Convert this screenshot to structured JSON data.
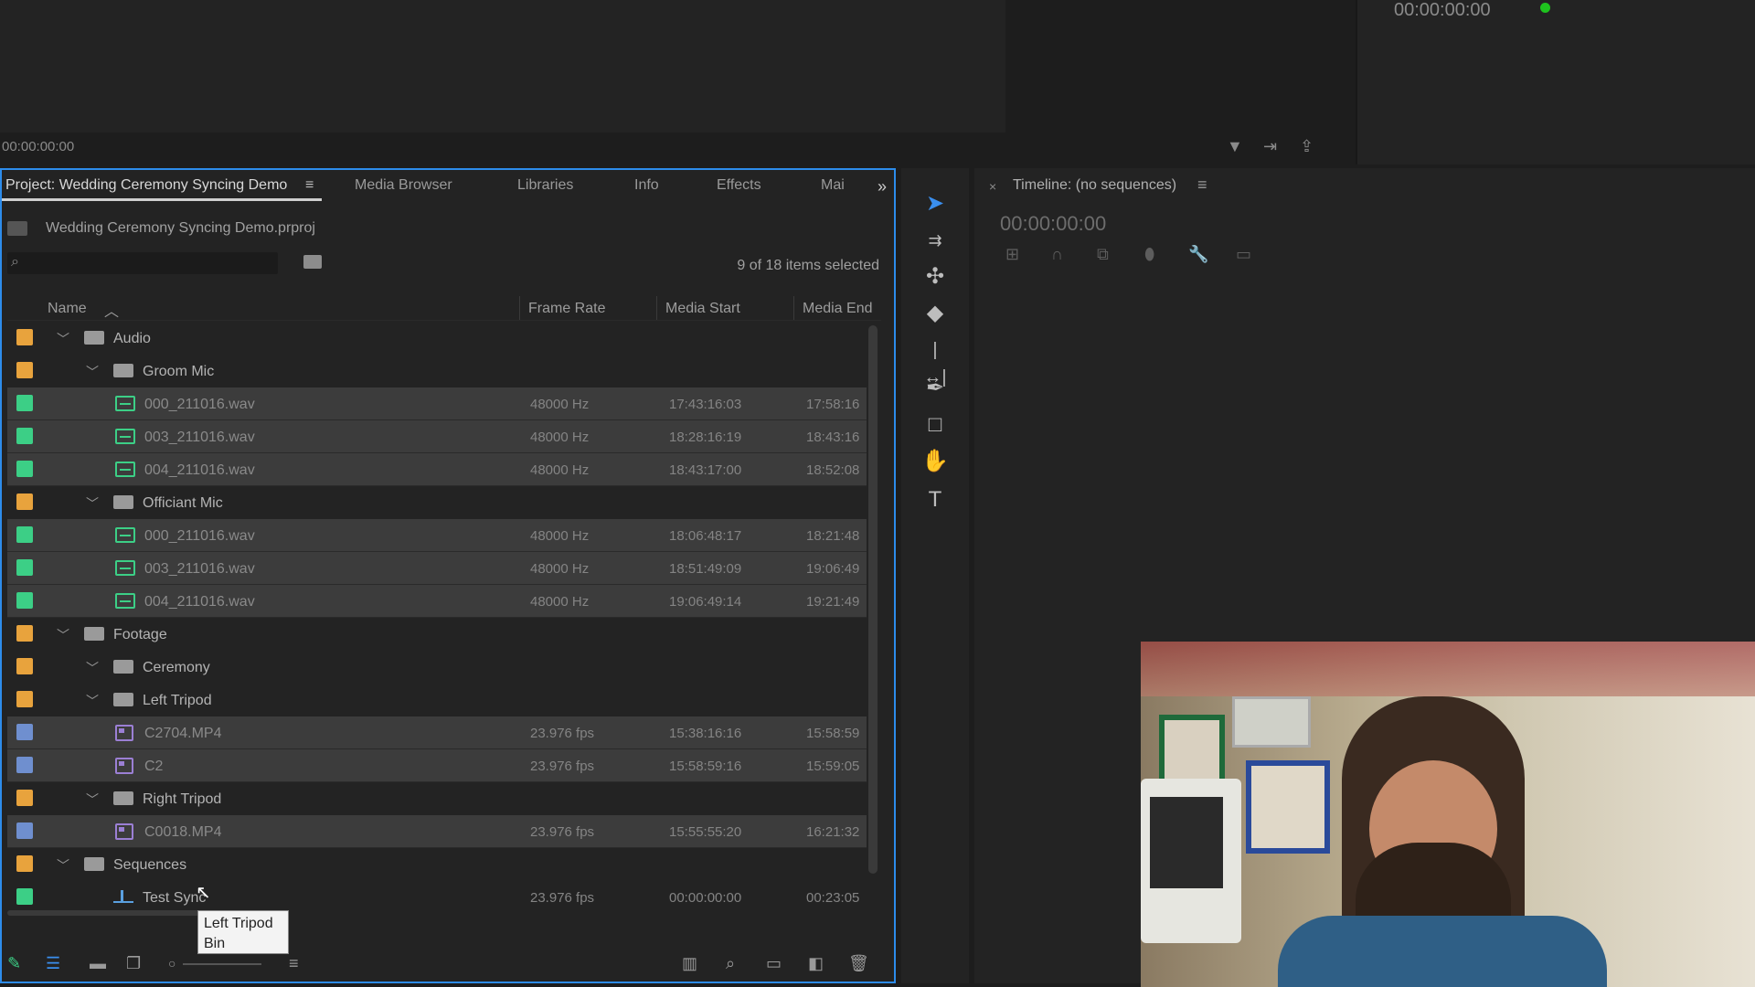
{
  "source_monitor": {
    "timecode": "00:00:00:00"
  },
  "program_monitor": {
    "timecode": "00:00:00:00"
  },
  "project_panel": {
    "tabs": [
      "Project: Wedding Ceremony Syncing Demo",
      "Media Browser",
      "Libraries",
      "Info",
      "Effects",
      "Mai"
    ],
    "file_name": "Wedding Ceremony Syncing Demo.prproj",
    "items_selected": "9 of 18 items selected",
    "columns": {
      "name": "Name",
      "frame_rate": "Frame Rate",
      "media_start": "Media Start",
      "media_end": "Media End"
    },
    "rows": [
      {
        "name": "Audio",
        "type": "folder",
        "indent": 0,
        "color": "#e8a33d",
        "selected": false
      },
      {
        "name": "Groom Mic",
        "type": "folder",
        "indent": 1,
        "color": "#e8a33d",
        "selected": false
      },
      {
        "name": "000_211016.wav",
        "type": "audio",
        "indent": 2,
        "color": "#3ccf86",
        "selected": true,
        "frame_rate": "48000 Hz",
        "media_start": "17:43:16:03",
        "media_end": "17:58:16"
      },
      {
        "name": "003_211016.wav",
        "type": "audio",
        "indent": 2,
        "color": "#3ccf86",
        "selected": true,
        "frame_rate": "48000 Hz",
        "media_start": "18:28:16:19",
        "media_end": "18:43:16"
      },
      {
        "name": "004_211016.wav",
        "type": "audio",
        "indent": 2,
        "color": "#3ccf86",
        "selected": true,
        "frame_rate": "48000 Hz",
        "media_start": "18:43:17:00",
        "media_end": "18:52:08"
      },
      {
        "name": "Officiant Mic",
        "type": "folder",
        "indent": 1,
        "color": "#e8a33d",
        "selected": false
      },
      {
        "name": "000_211016.wav",
        "type": "audio",
        "indent": 2,
        "color": "#3ccf86",
        "selected": true,
        "frame_rate": "48000 Hz",
        "media_start": "18:06:48:17",
        "media_end": "18:21:48"
      },
      {
        "name": "003_211016.wav",
        "type": "audio",
        "indent": 2,
        "color": "#3ccf86",
        "selected": true,
        "frame_rate": "48000 Hz",
        "media_start": "18:51:49:09",
        "media_end": "19:06:49"
      },
      {
        "name": "004_211016.wav",
        "type": "audio",
        "indent": 2,
        "color": "#3ccf86",
        "selected": true,
        "frame_rate": "48000 Hz",
        "media_start": "19:06:49:14",
        "media_end": "19:21:49"
      },
      {
        "name": "Footage",
        "type": "folder",
        "indent": 0,
        "color": "#e8a33d",
        "selected": false
      },
      {
        "name": "Ceremony",
        "type": "folder",
        "indent": 1,
        "color": "#e8a33d",
        "selected": false
      },
      {
        "name": "Left Tripod",
        "type": "folder",
        "indent": 1,
        "color": "#e8a33d",
        "selected": false
      },
      {
        "name": "C2704.MP4",
        "type": "video",
        "indent": 2,
        "color": "#6f8fcf",
        "selected": true,
        "frame_rate": "23.976 fps",
        "media_start": "15:38:16:16",
        "media_end": "15:58:59"
      },
      {
        "name": "C2",
        "type": "video",
        "indent": 2,
        "color": "#6f8fcf",
        "selected": true,
        "frame_rate": "23.976 fps",
        "media_start": "15:58:59:16",
        "media_end": "15:59:05"
      },
      {
        "name": "Right Tripod",
        "type": "folder",
        "indent": 1,
        "color": "#e8a33d",
        "selected": false
      },
      {
        "name": "C0018.MP4",
        "type": "video",
        "indent": 2,
        "color": "#6f8fcf",
        "selected": true,
        "frame_rate": "23.976 fps",
        "media_start": "15:55:55:20",
        "media_end": "16:21:32"
      },
      {
        "name": "Sequences",
        "type": "folder",
        "indent": 0,
        "color": "#e8a33d",
        "selected": false
      },
      {
        "name": "Test Sync",
        "type": "sequence",
        "indent": 1,
        "color": "#3ccf86",
        "selected": false,
        "frame_rate": "23.976 fps",
        "media_start": "00:00:00:00",
        "media_end": "00:23:05"
      }
    ],
    "tooltip": {
      "line1": "Left Tripod",
      "line2": "Bin"
    }
  },
  "timeline_panel": {
    "title": "Timeline: (no sequences)",
    "timecode": "00:00:00:00"
  },
  "icons": {
    "selection_tool": "selection-arrow-icon",
    "track_select": "track-select-icon",
    "ripple_edit": "ripple-edit-icon",
    "razor": "razor-icon",
    "slip": "slip-icon",
    "pen": "pen-icon",
    "rectangle": "rectangle-icon",
    "hand": "hand-icon",
    "type": "type-icon"
  },
  "colors": {
    "accent_blue": "#2d8ceb",
    "label_orange": "#e8a33d",
    "label_green": "#3ccf86",
    "label_blue": "#6f8fcf",
    "live_dot": "#1ec21e"
  }
}
